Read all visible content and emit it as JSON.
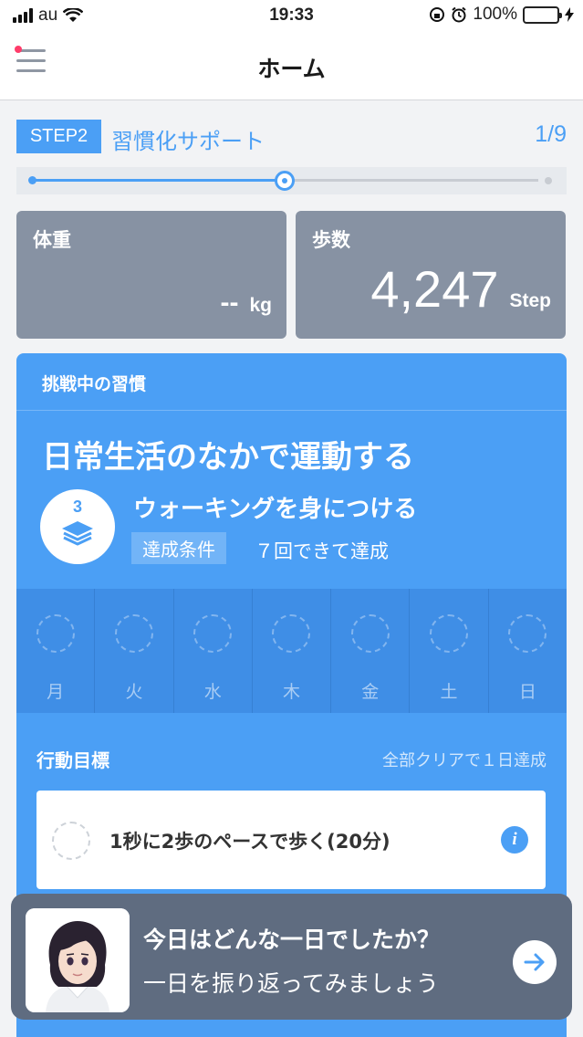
{
  "status_bar": {
    "carrier": "au",
    "time": "19:33",
    "battery": "100%",
    "battery_level": 1.0
  },
  "nav": {
    "title": "ホーム",
    "menu_icon": "hamburger-menu-icon"
  },
  "step": {
    "badge": "STEP2",
    "title": "習慣化サポート",
    "count": "1/9",
    "progress": 0.5
  },
  "stats": {
    "weight": {
      "label": "体重",
      "value": "--",
      "unit": "kg"
    },
    "steps": {
      "label": "歩数",
      "value": "4,247",
      "unit": "Step"
    }
  },
  "habit": {
    "header": "挑戦中の習慣",
    "title": "日常生活のなかで運動する",
    "level": "3",
    "level_icon": "stack-layers-icon",
    "subtitle": "ウォーキングを身につける",
    "condition_label": "達成条件",
    "condition_text": "７回できて達成",
    "week_days": [
      "月",
      "火",
      "水",
      "木",
      "金",
      "土",
      "日"
    ]
  },
  "goals": {
    "header": "行動目標",
    "note": "全部クリアで１日達成",
    "items": [
      {
        "text": "1秒に2歩のペースで歩く(20分)",
        "done": false
      }
    ]
  },
  "banner": {
    "title": "今日はどんな一日でしたか？",
    "subtitle": "一日を振り返ってみましょう",
    "button_icon": "arrow-right-icon"
  },
  "colors": {
    "accent": "#4b9ff5",
    "card_gray": "#8792a3",
    "banner_bg": "#5f6c80",
    "notification_dot": "#ff3c6a"
  }
}
